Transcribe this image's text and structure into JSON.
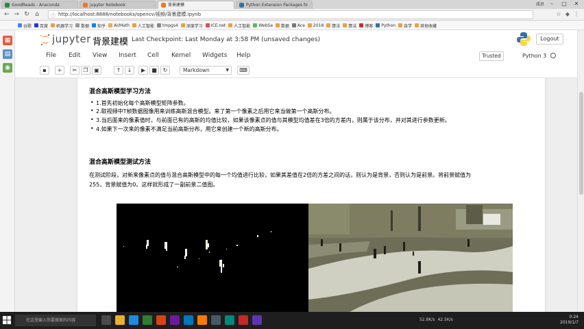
{
  "browser": {
    "tabs": [
      {
        "label": "GoodReads - Anaconda",
        "active": false
      },
      {
        "label": "jupyter Notebook",
        "active": false
      },
      {
        "label": "背景建模",
        "active": true
      },
      {
        "label": "Python Extension Packages fo",
        "active": false
      }
    ],
    "user": "成员",
    "url": "http://localhost:8888/notebooks/opencv/视频/背景建模.ipynb",
    "bookmarks": [
      "谷歌",
      "百度",
      "机器学习",
      "数据",
      "知乎",
      "AI/Math",
      "人工智能",
      "tmpgs4",
      "深度学习",
      "ICE.net",
      "人工智能",
      "WebSa",
      "数据",
      "Ace",
      "2018",
      "算法",
      "算法",
      "博客",
      "Python",
      "自学",
      "其他收藏"
    ]
  },
  "jupyter": {
    "logo_text": "jupyter",
    "notebook_name": "背景建模",
    "checkpoint": "Last Checkpoint: Last Monday at 3:58 PM (unsaved changes)",
    "logout": "Logout",
    "menu": [
      "File",
      "Edit",
      "View",
      "Insert",
      "Cell",
      "Kernel",
      "Widgets",
      "Help"
    ],
    "trusted": "Trusted",
    "kernel": "Python 3",
    "cell_type": "Markdown",
    "icons": [
      "save-icon",
      "plus-icon",
      "cut-icon",
      "copy-icon",
      "paste-icon",
      "arrow-up-icon",
      "arrow-down-icon",
      "run-icon",
      "stop-icon",
      "restart-icon",
      "keyboard-icon"
    ]
  },
  "notebook": {
    "section1_title": "混合高斯模型学习方法",
    "section1_items": [
      "1.首先初始化每个高斯模型矩阵参数。",
      "2.取视频中T帧数据图像用来训练高斯混合模型。来了第一个像素之后用它来当做第一个高斯分布。",
      "3.当后面来的像素值时，与前面已有的高斯的均值比较，如果该像素点的值与其模型均值差在3倍的方差内，则属于该分布，并对其进行参数更新。",
      "4.如果下一次来的像素不满足当前高斯分布，用它来创建一个新的高斯分布。"
    ],
    "section2_title": "混合高斯模型测试方法",
    "section2_line1": "在测试阶段，对新来像素点的值与混合高斯模型中的每一个均值进行比较，如果其差值在2倍的方差之间的话，则认为是背景，否则认为是前景。将前景赋值为",
    "section2_line2": "255，背景赋值为0。这样就形成了一副前景二值图。"
  },
  "taskbar": {
    "search": "在这里输入你要搜索的内容",
    "chips": [
      "52.8K/s",
      "42.5K/s"
    ],
    "time": "0:24",
    "date": "2019/1/7"
  }
}
